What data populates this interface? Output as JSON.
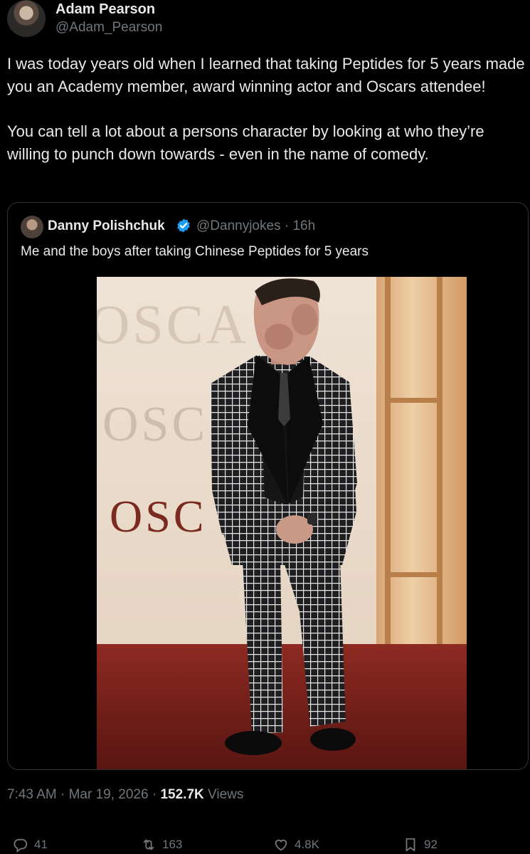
{
  "tweet": {
    "author_name": "Adam Pearson",
    "author_handle": "@Adam_Pearson",
    "paragraphs": [
      "I was today years old when I learned that taking Peptides for 5 years made you an Academy member, award winning actor and Oscars attendee!",
      "You can tell a lot about a persons character by looking at who they’re willing to punch down towards - even in the name of comedy."
    ],
    "time": "7:43 AM",
    "date": "Mar 19, 2026",
    "views_count": "152.7K",
    "views_label": "Views"
  },
  "quoted": {
    "author_name": "Danny Polishchuk",
    "author_handle": "@Dannyjokes",
    "age": "16h",
    "text": "Me and the boys after taking Chinese Peptides for  5 years",
    "photo_signage": [
      "OSCA",
      "OSC",
      "OSC"
    ]
  },
  "actions": {
    "replies": "41",
    "reposts": "163",
    "likes": "4.8K",
    "bookmarks": "92"
  },
  "icons": {
    "verified": "verified-badge-icon",
    "reply": "reply-icon",
    "repost": "repost-icon",
    "like": "heart-icon",
    "bookmark": "bookmark-icon"
  },
  "colors": {
    "background": "#000000",
    "text": "#e7e9ea",
    "secondary": "#71767b",
    "verified": "#1d9bf0",
    "border": "#2f3336"
  }
}
